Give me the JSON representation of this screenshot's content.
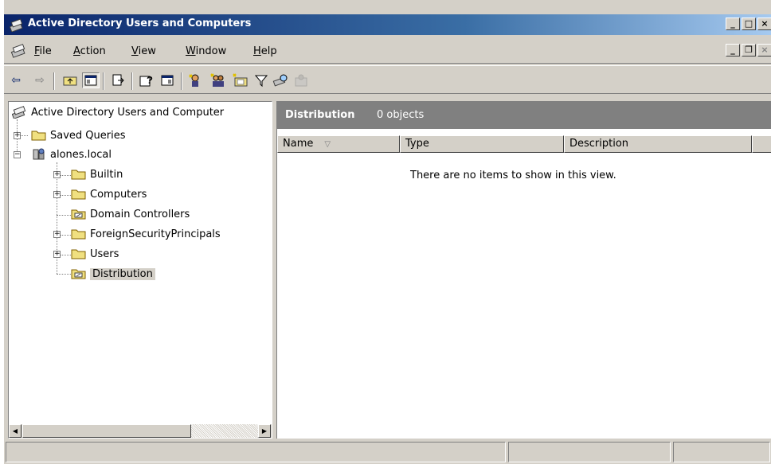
{
  "window": {
    "title": "Active Directory Users and Computers",
    "caption_buttons": [
      "_",
      "□",
      "×"
    ]
  },
  "menubar": {
    "items": [
      {
        "label": "File",
        "accel": "F",
        "rest": "ile"
      },
      {
        "label": "Action",
        "accel": "A",
        "rest": "ction"
      },
      {
        "label": "View",
        "accel": "V",
        "rest": "iew"
      },
      {
        "label": "Window",
        "accel": "W",
        "rest": "indow"
      },
      {
        "label": "Help",
        "accel": "H",
        "rest": "elp"
      }
    ],
    "mdi_buttons": [
      "_",
      "❐",
      "×"
    ]
  },
  "toolbar": {
    "buttons": [
      "back-icon",
      "forward-icon",
      "up-folder-icon",
      "show-hide-tree-icon",
      "export-list-icon",
      "help-icon",
      "console-icon",
      "create-user-icon",
      "create-group-icon",
      "create-ou-icon",
      "filter-icon",
      "find-icon",
      "add-to-group-icon"
    ]
  },
  "tree": {
    "root": "Active Directory Users and Computer",
    "saved_queries": "Saved Queries",
    "domain": "alones.local",
    "children": [
      {
        "label": "Builtin",
        "type": "folder",
        "expandable": true
      },
      {
        "label": "Computers",
        "type": "folder",
        "expandable": true
      },
      {
        "label": "Domain Controllers",
        "type": "ou",
        "expandable": false
      },
      {
        "label": "ForeignSecurityPrincipals",
        "type": "folder",
        "expandable": true
      },
      {
        "label": "Users",
        "type": "folder",
        "expandable": true
      },
      {
        "label": "Distribution",
        "type": "ou",
        "expandable": false,
        "selected": true
      }
    ]
  },
  "detail": {
    "folder_name": "Distribution",
    "object_count": "0 objects",
    "columns": [
      "Name",
      "Type",
      "Description"
    ],
    "empty_message": "There are no items to show in this view."
  },
  "colors": {
    "title_gradient_start": "#0a246a",
    "title_gradient_end": "#a6caf0",
    "chrome": "#d4d0c8",
    "detail_header": "#808080"
  }
}
